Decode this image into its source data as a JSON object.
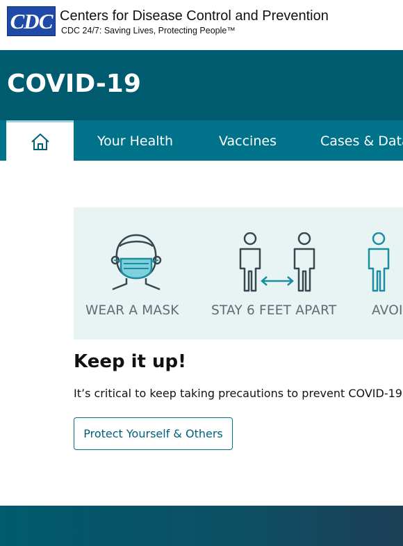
{
  "header": {
    "logo_text": "CDC",
    "agency_name": "Centers for Disease Control and Prevention",
    "tagline": "CDC 24/7: Saving Lives, Protecting People™"
  },
  "title_band": {
    "title": "COVID-19"
  },
  "nav": {
    "home_icon": "home-icon",
    "items": [
      {
        "label": "Your Health"
      },
      {
        "label": "Vaccines"
      },
      {
        "label": "Cases & Data"
      }
    ]
  },
  "promo": {
    "captions": [
      "WEAR A MASK",
      "STAY 6 FEET APART",
      "AVOI"
    ],
    "heading": "Keep it up!",
    "text": "It’s critical to keep taking precautions to prevent COVID-19.",
    "button_label": "Protect Yourself & Others"
  },
  "colors": {
    "brand_blue": "#1f4aa8",
    "title_band": "#005b6e",
    "nav": "#00738a",
    "illustration_bg": "#e8f3f4",
    "accent_teal": "#1a8ea0"
  }
}
